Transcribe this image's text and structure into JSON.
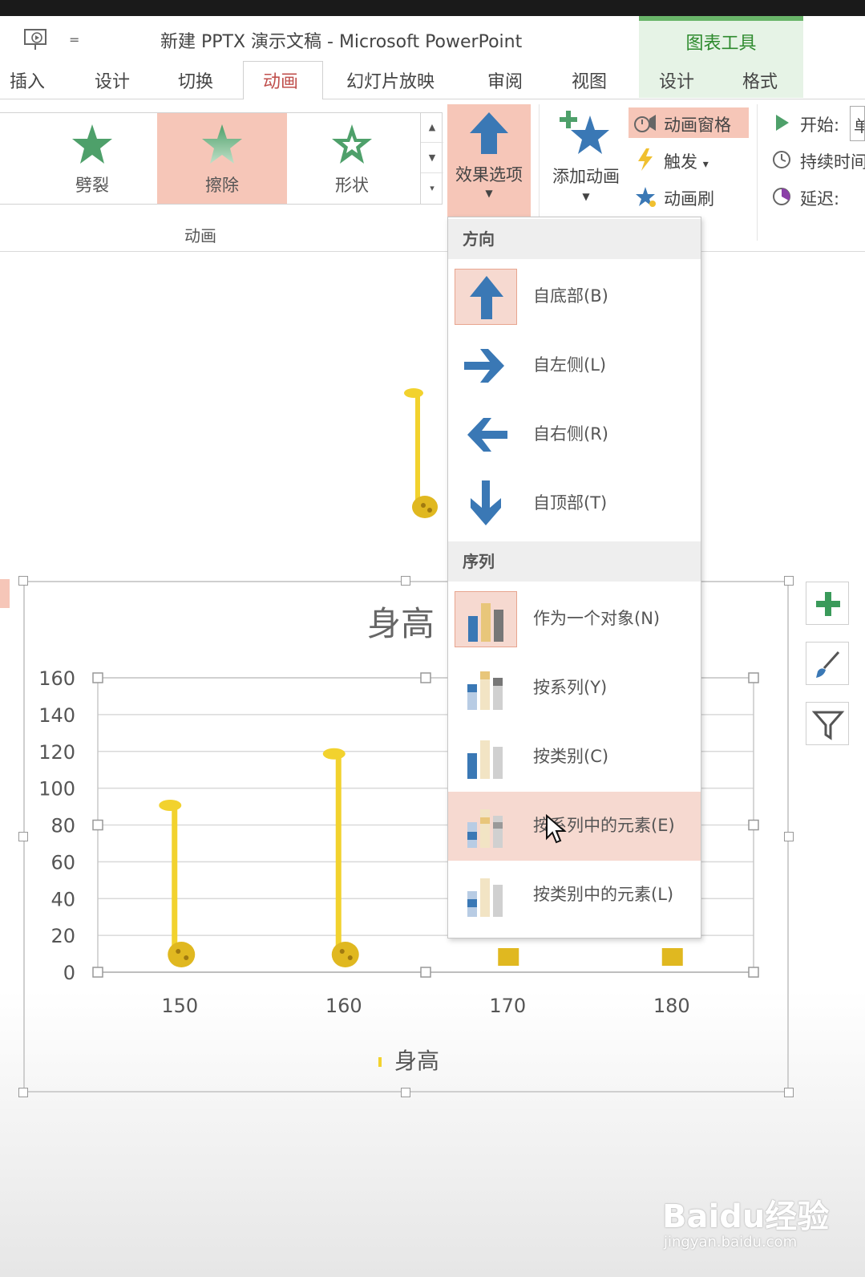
{
  "window": {
    "title": "新建 PPTX 演示文稿 - Microsoft PowerPoint",
    "context_group": "图表工具"
  },
  "tabs": [
    {
      "label": "插入",
      "active": false
    },
    {
      "label": "设计",
      "active": false
    },
    {
      "label": "切换",
      "active": false
    },
    {
      "label": "动画",
      "active": true
    },
    {
      "label": "幻灯片放映",
      "active": false
    },
    {
      "label": "审阅",
      "active": false
    },
    {
      "label": "视图",
      "active": false
    },
    {
      "label": "设计",
      "active": false
    },
    {
      "label": "格式",
      "active": false
    }
  ],
  "ribbon": {
    "gallery": [
      {
        "label": "劈裂",
        "selected": false,
        "icon": "star-icon"
      },
      {
        "label": "擦除",
        "selected": true,
        "icon": "star-icon"
      },
      {
        "label": "形状",
        "selected": false,
        "icon": "star-outline-icon"
      }
    ],
    "group_label": "动画",
    "effect_options": "效果选项",
    "add_animation": "添加动画",
    "animation_pane": "动画窗格",
    "trigger": "触发",
    "trigger_caret": "▾",
    "animation_painter": "动画刷",
    "start_label": "开始:",
    "duration_label": "持续时间",
    "delay_label": "延迟:",
    "start_value": "单"
  },
  "dropdown": {
    "direction_header": "方向",
    "direction_items": [
      {
        "label": "自底部(B)",
        "icon": "arrow-up-icon",
        "checked": true
      },
      {
        "label": "自左侧(L)",
        "icon": "arrow-right-icon",
        "checked": false
      },
      {
        "label": "自右侧(R)",
        "icon": "arrow-left-icon",
        "checked": false
      },
      {
        "label": "自顶部(T)",
        "icon": "arrow-down-icon",
        "checked": false
      }
    ],
    "sequence_header": "序列",
    "sequence_items": [
      {
        "label": "作为一个对象(N)",
        "checked": true,
        "hover": false
      },
      {
        "label": "按系列(Y)",
        "checked": false,
        "hover": false
      },
      {
        "label": "按类别(C)",
        "checked": false,
        "hover": false
      },
      {
        "label": "按系列中的元素(E)",
        "checked": false,
        "hover": true
      },
      {
        "label": "按类别中的元素(L)",
        "checked": false,
        "hover": false
      }
    ]
  },
  "chart_data": {
    "type": "bar",
    "title": "身高",
    "categories": [
      "150",
      "160",
      "170",
      "180"
    ],
    "series": [
      {
        "name": "身高",
        "values": [
          92,
          120,
          null,
          null
        ]
      }
    ],
    "ylim": [
      0,
      160
    ],
    "yticks": [
      0,
      20,
      40,
      60,
      80,
      100,
      120,
      140,
      160
    ],
    "grid": true,
    "legend_position": "bottom",
    "bar_style": "giraffe picture fill",
    "bar_color": "#f2d22e"
  },
  "colors": {
    "accent": "#c0504d",
    "selection": "#f6c6b8",
    "arrow_blue": "#3a78b5",
    "star_green": "#4ea06a",
    "chart_tools_green": "#2d8a2d"
  },
  "watermark": {
    "brand": "Baidu经验",
    "url": "jingyan.baidu.com"
  }
}
